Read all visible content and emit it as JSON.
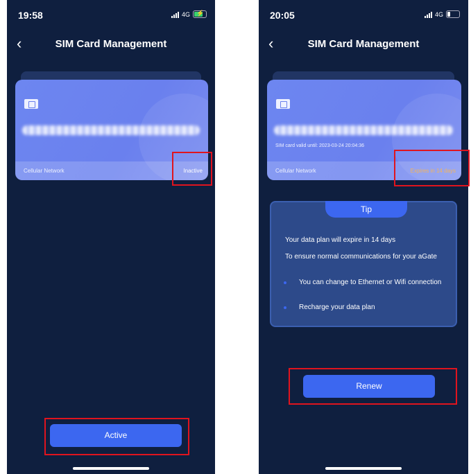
{
  "left_screen": {
    "status": {
      "time": "19:58",
      "network": "4G"
    },
    "nav": {
      "title": "SIM Card Management"
    },
    "card": {
      "network_label": "Cellular Network",
      "status": "Inactive"
    },
    "action_button": "Active"
  },
  "right_screen": {
    "status": {
      "time": "20:05",
      "network": "4G"
    },
    "nav": {
      "title": "SIM Card Management"
    },
    "card": {
      "valid_until": "SIM card valid until: 2023-03-24 20:04:36",
      "network_label": "Cellular Network",
      "status": "Expires in 14 days"
    },
    "tip": {
      "title": "Tip",
      "message": "Your data plan will expire in 14 days",
      "intro": "To ensure normal communications for your aGate",
      "bullets": [
        "You can change to Ethernet or Wifi connection",
        "Recharge your data plan"
      ]
    },
    "action_button": "Renew"
  },
  "colors": {
    "background": "#0f1f3f",
    "card": "#6a80ee",
    "button": "#3c67f0",
    "highlight_box": "#e0141e",
    "warning_text": "#f4b55b"
  },
  "icons": [
    "back-chevron-icon",
    "signal-bars-icon",
    "battery-icon",
    "sim-chip-icon"
  ]
}
